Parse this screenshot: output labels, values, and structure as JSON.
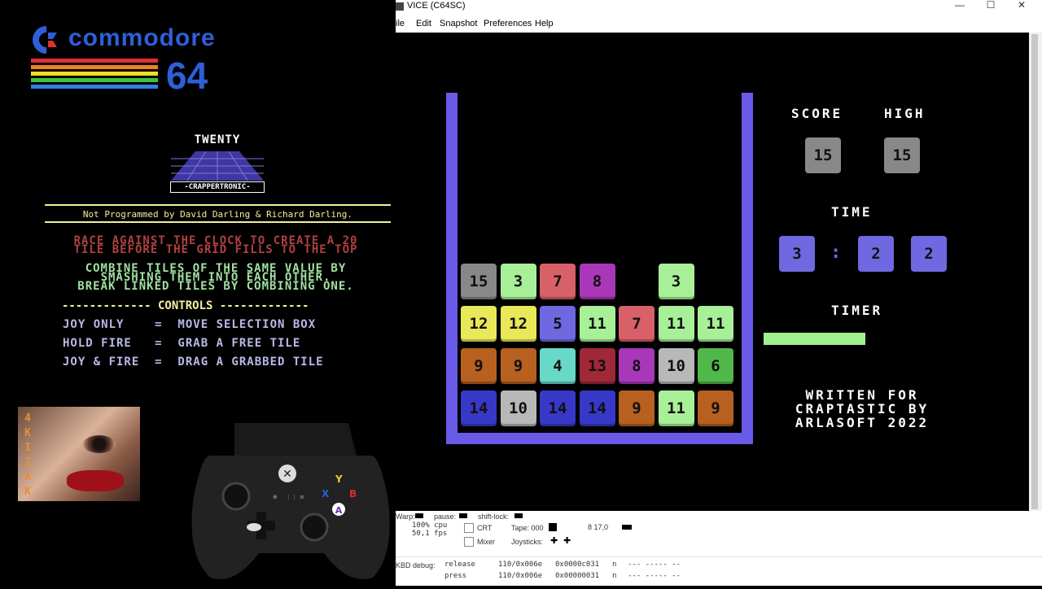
{
  "overlay": {
    "logo_text": "commodore",
    "logo_number": "64",
    "game_title": "TWENTY",
    "publisher": "-CRAPPERTRONIC-",
    "credits": "Not Programmed by David Darling & Richard Darling.",
    "race_line1": "RACE AGAINST THE CLOCK TO CREATE A 20",
    "race_line2": "TILE BEFORE THE GRID FILLS TO THE TOP",
    "combine_line1": "COMBINE TILES OF THE SAME VALUE BY",
    "combine_line2": "SMASHING THEM INTO EACH OTHER.",
    "combine_line3": "BREAK LINKED TILES BY COMBINING ONE.",
    "controls_header": "------------- CONTROLS -------------",
    "controls": [
      {
        "text": "JOY ONLY    =  MOVE SELECTION BOX"
      },
      {
        "text": "HOLD FIRE   =  GRAB A FREE TILE"
      },
      {
        "text": "JOY & FIRE  =  DRAG A GRABBED TILE"
      }
    ],
    "avatar_letters": "4KIZAK",
    "stripe_colors": [
      "#e03030",
      "#f08020",
      "#f0e020",
      "#40c040",
      "#3080e0"
    ]
  },
  "controller": {
    "y": "Y",
    "x": "X",
    "b": "B",
    "a": "A",
    "colors": {
      "y": "#e8d020",
      "x": "#2060e0",
      "b": "#d03030",
      "a": "#ffffff"
    }
  },
  "vice": {
    "title": "VICE (C64SC)",
    "window_buttons": {
      "minimize": "—",
      "maximize": "☐",
      "close": "✕"
    },
    "menu": [
      "ile",
      "Edit",
      "Snapshot",
      "Preferences",
      "Help"
    ],
    "status": {
      "warp": "Warp:",
      "pause": "pause:",
      "shift_lock": "shift-lock:",
      "cpu": "100% cpu",
      "fps": "50,1 fps",
      "crt": "CRT",
      "mixer": "Mixer",
      "tape": "Tape: 000",
      "joysticks": "Joysticks:",
      "drive": "8 17,0",
      "kbd_debug": "KBD debug:",
      "release_label": "release",
      "release_val1": "110/0x006e",
      "release_val2": "0x0000c031",
      "release_val3": "n",
      "release_val4": "--- ----- --",
      "press_label": "press",
      "press_val1": "110/0x006e",
      "press_val2": "0x00000031",
      "press_val3": "n",
      "press_val4": "--- ----- --"
    }
  },
  "game": {
    "score_label": "SCORE",
    "high_label": "HIGH",
    "score": "15",
    "high": "15",
    "time_label": "TIME",
    "time_minutes": "3",
    "time_sep": ":",
    "time_tens": "2",
    "time_units": "2",
    "timer_label": "TIMER",
    "timer_fill": 0.5,
    "written_line1": "WRITTEN FOR",
    "written_line2": "CRAPTASTIC BY",
    "written_line3": "ARLASOFT 2022",
    "tile_colors": {
      "3": "#a8f098",
      "4": "#68d8c8",
      "5": "#7068e0",
      "6": "#50b848",
      "7": "#d86068",
      "8": "#a838b8",
      "9": "#b86020",
      "10": "#b8b8b8",
      "11": "#a8f098",
      "12": "#e8e858",
      "13": "#a02838",
      "14": "#3838c8",
      "15": "#888888"
    },
    "rows": [
      [
        "15",
        "3",
        "7",
        "8",
        "",
        "3",
        ""
      ],
      [
        "12",
        "12",
        "5",
        "11",
        "7",
        "11",
        "11"
      ],
      [
        "9",
        "9",
        "4",
        "13",
        "8",
        "10",
        "6"
      ],
      [
        "14",
        "10",
        "14",
        "14",
        "9",
        "11",
        "9"
      ]
    ]
  }
}
